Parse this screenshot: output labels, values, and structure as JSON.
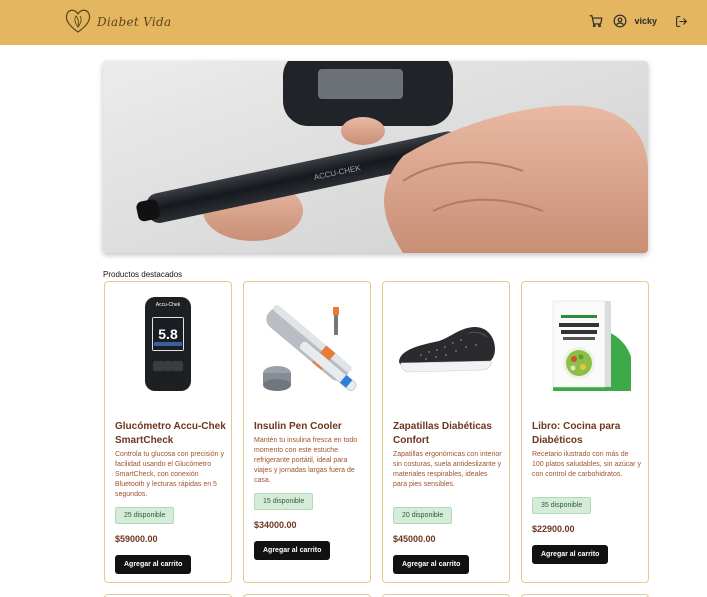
{
  "header": {
    "brand": "Diabet Vida",
    "user_name": "vicky",
    "icons": [
      "leaf-heart-logo",
      "cart-icon",
      "user-circle-icon",
      "logout-icon"
    ]
  },
  "hero": {
    "alt": "glucometer-lancing-device-photo"
  },
  "featured": {
    "title": "Productos destacados",
    "products": [
      {
        "name": "Glucómetro Accu-Chek SmartCheck",
        "description": "Controla tu glucosa con precisión y facilidad usando el Glucómetro SmartCheck, con conexión Bluetooth y lecturas rápidas en 5 segundos.",
        "stock": "25 disponible",
        "price": "$59000.00",
        "button": "Agregar al carrito",
        "device_label": "Accu-Chek",
        "device_reading": "5.8"
      },
      {
        "name": "Insulin Pen Cooler",
        "description": "Mantén tu insulina fresca en todo momento con este estuche refrigerante portátil, ideal para viajes y jornadas largas fuera de casa.",
        "stock": "15 disponible",
        "price": "$34000.00",
        "button": "Agregar al carrito"
      },
      {
        "name": "Zapatillas Diabéticas Confort",
        "description": "Zapatillas ergonómicas con interior sin costuras, suela antideslizante y materiales respirables, ideales para pies sensibles.",
        "stock": "20 disponible",
        "price": "$45000.00",
        "button": "Agregar al carrito"
      },
      {
        "name": "Libro: Cocina para Diabéticos",
        "description": "Recetario ilustrado con más de 100 platos saludables, sin azúcar y con control de carbohidratos.",
        "stock": "35 disponible",
        "price": "$22900.00",
        "button": "Agregar al carrito"
      }
    ]
  },
  "colors": {
    "header_bg": "#e4b65f",
    "card_border": "#e8c98a",
    "title_brown": "#6e3620",
    "stock_green_bg": "#d4ecd8",
    "button_black": "#111111"
  }
}
